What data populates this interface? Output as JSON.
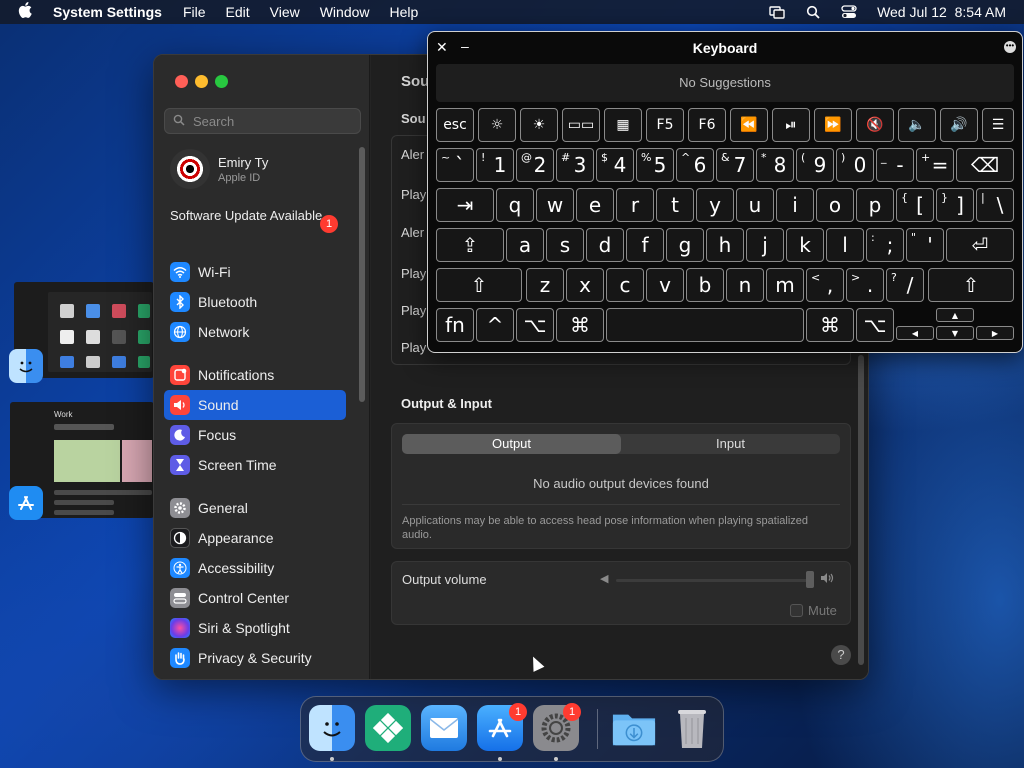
{
  "menubar": {
    "app_name": "System Settings",
    "menus": [
      "File",
      "Edit",
      "View",
      "Window",
      "Help"
    ],
    "clock": "Wed Jul 12  8:54 AM"
  },
  "sidebar": {
    "search_placeholder": "Search",
    "account_name": "Emiry Ty",
    "account_sub": "Apple ID",
    "software_update": "Software Update Available",
    "software_update_badge": "1",
    "items": [
      {
        "label": "Wi-Fi",
        "color": "#1e88ff"
      },
      {
        "label": "Bluetooth",
        "color": "#1e88ff"
      },
      {
        "label": "Network",
        "color": "#1e88ff"
      },
      {
        "label": "Notifications",
        "color": "#ff453a"
      },
      {
        "label": "Sound",
        "color": "#ff453a"
      },
      {
        "label": "Focus",
        "color": "#5e5ce6"
      },
      {
        "label": "Screen Time",
        "color": "#5e5ce6"
      },
      {
        "label": "General",
        "color": "#8e8e93"
      },
      {
        "label": "Appearance",
        "color": "#1c1c1e"
      },
      {
        "label": "Accessibility",
        "color": "#1e88ff"
      },
      {
        "label": "Control Center",
        "color": "#8e8e93"
      },
      {
        "label": "Siri & Spotlight",
        "color": "#bf5af2"
      },
      {
        "label": "Privacy & Security",
        "color": "#1e88ff"
      }
    ],
    "selected": "Sound"
  },
  "content": {
    "title_clip": "Sou",
    "section_clip": "Sou",
    "rows_clip": [
      "Aler",
      "Play",
      "Aler",
      "Play",
      "Play",
      "Play"
    ],
    "output_input_title": "Output & Input",
    "tab_output": "Output",
    "tab_input": "Input",
    "no_devices": "No audio output devices found",
    "head_pose_note": "Applications may be able to access head pose information when playing spatialized audio.",
    "volume_label": "Output volume",
    "mute_label": "Mute",
    "help": "?"
  },
  "keyboard": {
    "title": "Keyboard",
    "suggestions": "No Suggestions",
    "fn_row": [
      "esc",
      "☼",
      "☀",
      "▭▭",
      "▦",
      "F5",
      "F6",
      "⏪",
      "⏯",
      "⏩",
      "🔇",
      "🔈",
      "🔊",
      "☰"
    ],
    "num_row_shift": [
      "~",
      "!",
      "@",
      "#",
      "$",
      "%",
      "^",
      "&",
      "*",
      "(",
      ")",
      "_",
      "+"
    ],
    "num_row_main": [
      "`",
      "1",
      "2",
      "3",
      "4",
      "5",
      "6",
      "7",
      "8",
      "9",
      "0",
      "-",
      "="
    ],
    "top_row": [
      "q",
      "w",
      "e",
      "r",
      "t",
      "y",
      "u",
      "i",
      "o",
      "p"
    ],
    "top_row_extra_shift": [
      "{",
      "}",
      "|"
    ],
    "top_row_extra_main": [
      "[",
      "]",
      "\\"
    ],
    "home_row": [
      "a",
      "s",
      "d",
      "f",
      "g",
      "h",
      "j",
      "k",
      "l"
    ],
    "home_row_extra_shift": [
      ":",
      "\""
    ],
    "home_row_extra_main": [
      ";",
      "'"
    ],
    "bottom_row": [
      "z",
      "x",
      "c",
      "v",
      "b",
      "n",
      "m"
    ],
    "bottom_row_extra_shift": [
      "<",
      ">",
      "?"
    ],
    "bottom_row_extra_main": [
      ",",
      ".",
      "/"
    ],
    "tab": "⇥",
    "delete": "⌫",
    "return": "⏎",
    "caps": "⇪",
    "shift": "⇧",
    "fn": "fn",
    "ctrl": "^",
    "option": "⌥",
    "command": "⌘",
    "arrow_up": "▲",
    "arrow_down": "▼",
    "arrow_left": "◀",
    "arrow_right": "▶"
  },
  "desktop": {
    "thumb_title": "Work"
  },
  "dock": {
    "apps": [
      {
        "name": "Finder",
        "color": "#3a8ef0"
      },
      {
        "name": "Kiwi",
        "color": "#1fae7a"
      },
      {
        "name": "Mail",
        "color": "#3ea0ff"
      },
      {
        "name": "App Store",
        "color": "#1f8cf2",
        "badge": "1"
      },
      {
        "name": "System Settings",
        "color": "#8a8a8e",
        "badge": "1"
      },
      {
        "name": "Downloads",
        "color": "#5fb0f0"
      },
      {
        "name": "Trash",
        "color": "#9a9aa0"
      }
    ]
  }
}
